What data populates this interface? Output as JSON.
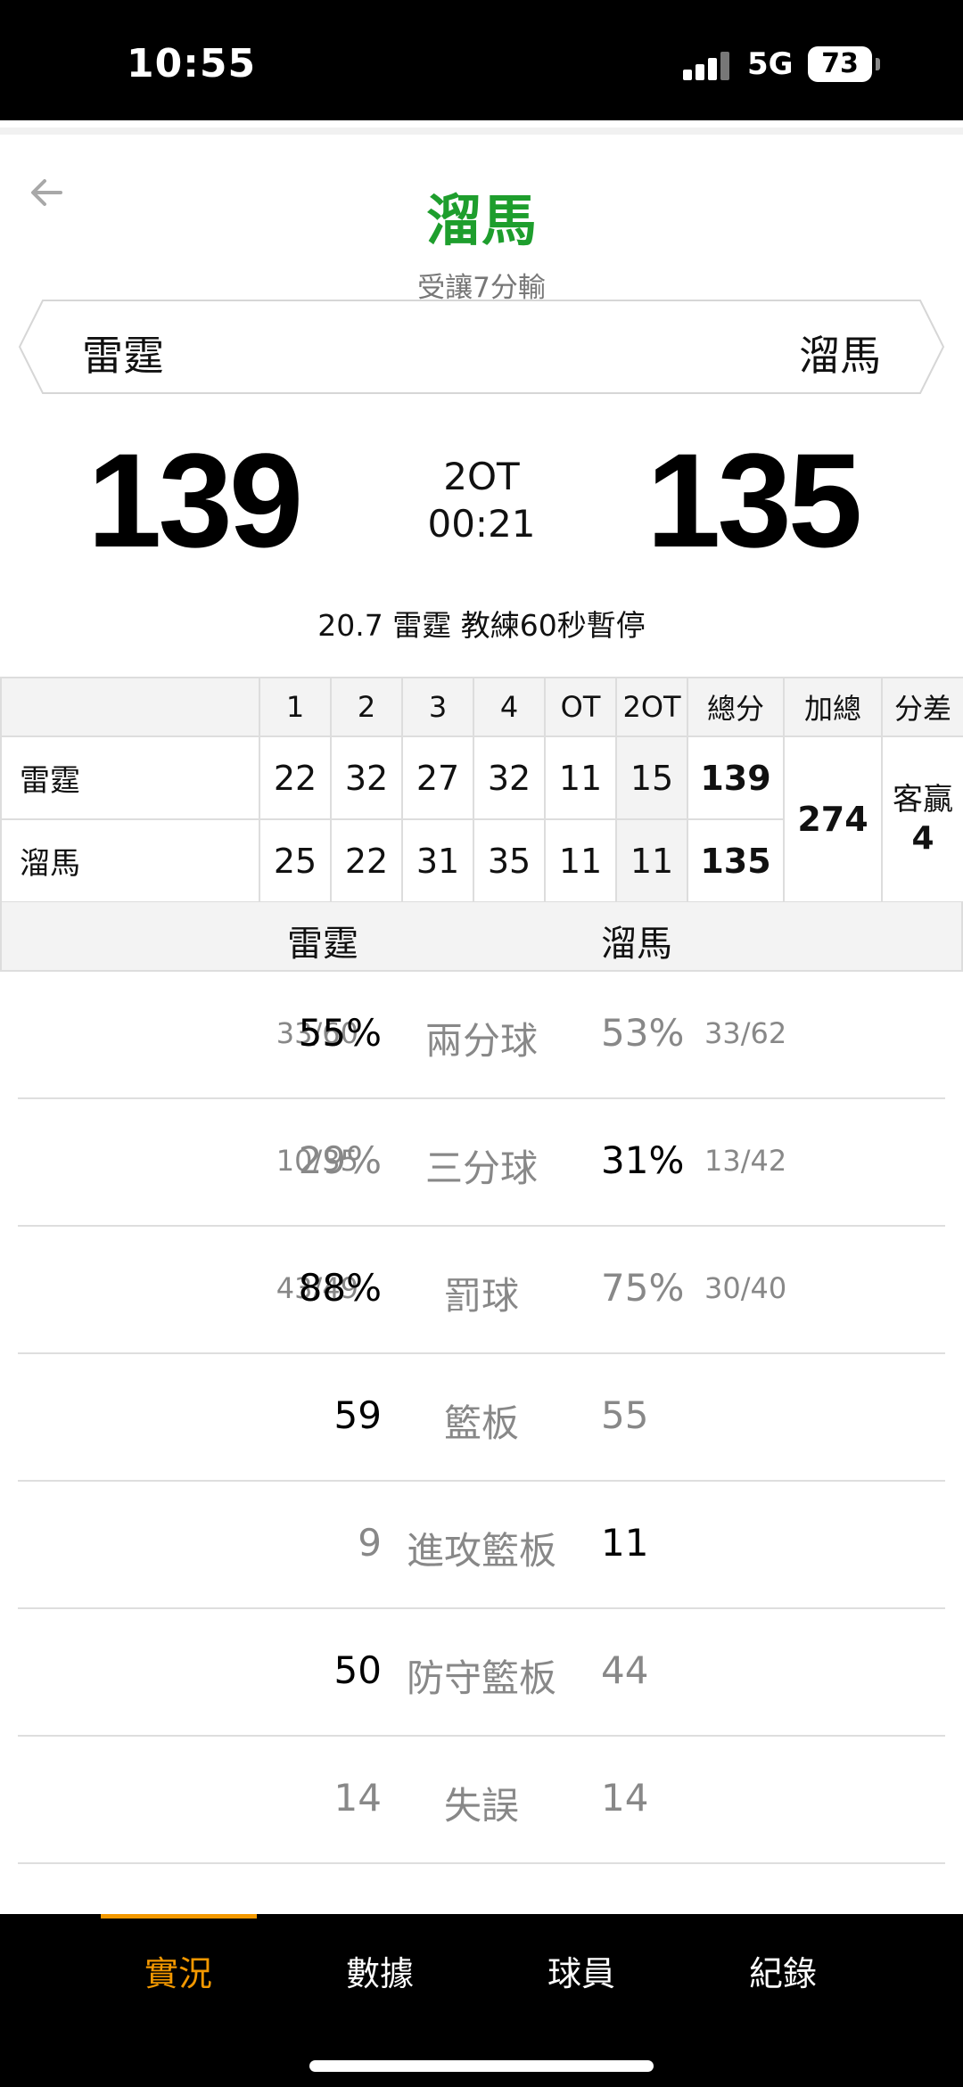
{
  "status_bar": {
    "time": "10:55",
    "network": "5G",
    "battery": "73"
  },
  "game": {
    "winner": "溜馬",
    "handicap_text": "受讓7分輸",
    "home_team": "雷霆",
    "away_team": "溜馬",
    "home_score": "139",
    "away_score": "135",
    "period": "2OT",
    "clock": "00:21",
    "event": "20.7 雷霆  教練60秒暫停"
  },
  "box_score": {
    "headers": [
      "",
      "1",
      "2",
      "3",
      "4",
      "OT",
      "2OT",
      "總分",
      "加總",
      "分差"
    ],
    "rows": [
      {
        "team": "雷霆",
        "scores": [
          "22",
          "32",
          "27",
          "32",
          "11",
          "15"
        ],
        "total": "139"
      },
      {
        "team": "溜馬",
        "scores": [
          "25",
          "22",
          "31",
          "35",
          "11",
          "11"
        ],
        "total": "135"
      }
    ],
    "combined": "274",
    "diff_label": "客贏",
    "diff_value": "4"
  },
  "stats": {
    "home_team": "雷霆",
    "away_team": "溜馬",
    "rows": [
      {
        "name": "兩分球",
        "home_att": "33/60",
        "home_val": "55%",
        "away_val": "53%",
        "away_att": "33/62",
        "leader": "home"
      },
      {
        "name": "三分球",
        "home_att": "10/35",
        "home_val": "29%",
        "away_val": "31%",
        "away_att": "13/42",
        "leader": "away"
      },
      {
        "name": "罰球",
        "home_att": "43/49",
        "home_val": "88%",
        "away_val": "75%",
        "away_att": "30/40",
        "leader": "home"
      },
      {
        "name": "籃板",
        "home_att": "",
        "home_val": "59",
        "away_val": "55",
        "away_att": "",
        "leader": "home"
      },
      {
        "name": "進攻籃板",
        "home_att": "",
        "home_val": "9",
        "away_val": "11",
        "away_att": "",
        "leader": "away"
      },
      {
        "name": "防守籃板",
        "home_att": "",
        "home_val": "50",
        "away_val": "44",
        "away_att": "",
        "leader": "home"
      },
      {
        "name": "失誤",
        "home_att": "",
        "home_val": "14",
        "away_val": "14",
        "away_att": "",
        "leader": "none"
      }
    ]
  },
  "nav": {
    "tabs": [
      "實況",
      "數據",
      "球員",
      "紀錄"
    ],
    "active_index": 0
  },
  "colors": {
    "accent": "#f39800",
    "winner": "#1e9e2d"
  },
  "icons": {
    "back": "arrow-left-icon",
    "signal": "cellular-signal-icon",
    "battery": "battery-icon"
  }
}
